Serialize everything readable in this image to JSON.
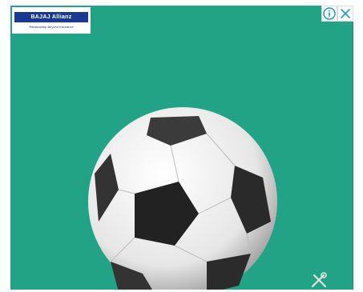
{
  "ad": {
    "brand_logo_text": "BAJAJ Allianz",
    "brand_tagline": "Relationship Beyond Insurance",
    "background_color": "#22a385",
    "brand_color": "#1a3a8f",
    "image_name": "soccer-ball"
  },
  "controls": {
    "adchoices_icon": "info-icon",
    "close_icon": "close-icon",
    "accent_color": "#1a9ad6"
  }
}
